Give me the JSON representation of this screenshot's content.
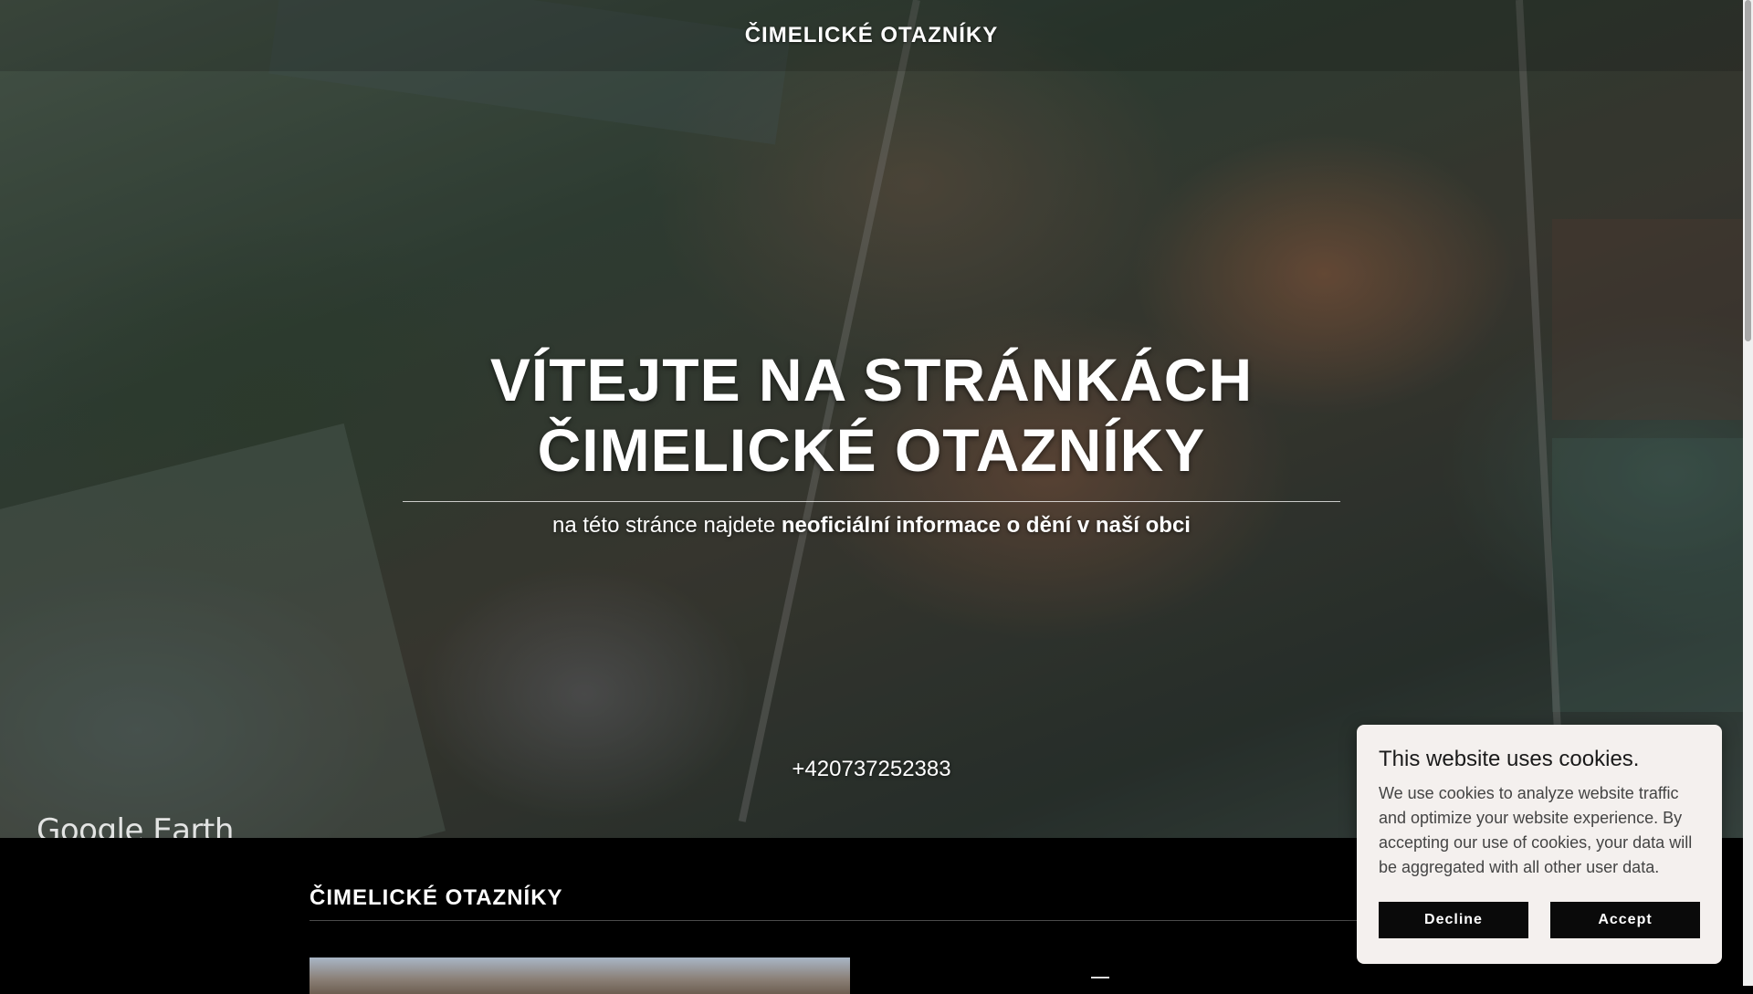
{
  "header": {
    "brand": "ČIMELICKÉ OTAZNÍKY"
  },
  "hero": {
    "title_line1": "VÍTEJTE NA STRÁNKÁCH",
    "title_line2": "ČIMELICKÉ OTAZNÍKY",
    "tagline_prefix": "na této stránce najdete ",
    "tagline_bold": "neoficiální informace o dění v naší obci",
    "phone": "+420737252383",
    "watermark": "Google Earth"
  },
  "section": {
    "title": "ČIMELICKÉ OTAZNÍKY"
  },
  "cookie": {
    "title": "This website uses cookies.",
    "text": "We use cookies to analyze website traffic and optimize your website experience. By accepting our use of cookies, your data will be aggregated with all other user data.",
    "decline_label": "Decline",
    "accept_label": "Accept"
  }
}
